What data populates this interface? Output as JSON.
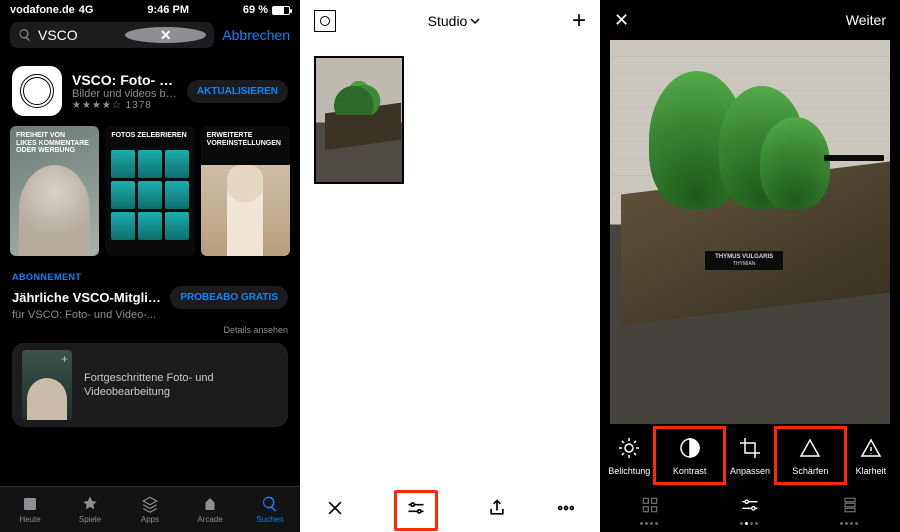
{
  "statusbar": {
    "carrier": "vodafone.de",
    "network": "4G",
    "time": "9:46 PM",
    "battery": "69 %"
  },
  "search": {
    "query": "VSCO",
    "cancel": "Abbrechen"
  },
  "app": {
    "name": "VSCO: Foto- und...",
    "subtitle": "Bilder und videos be...",
    "ratingCount": "1378",
    "action": "AKTUALISIEREN"
  },
  "shots": {
    "s1a": "FREIHEIT VON",
    "s1b": "LIKES KOMMENTARE ODER WERBUNG",
    "s2": "FOTOS ZELEBRIEREN",
    "s3": "ERWEITERTE VOREINSTELLUNGEN"
  },
  "abon": {
    "heading": "ABONNEMENT",
    "title": "Jährliche VSCO-Mitglied...",
    "subtitle": "für VSCO: Foto- und Video-...",
    "trial": "PROBEABO GRATIS",
    "details": "Details ansehen"
  },
  "promo": {
    "line1": "Fortgeschrittene Foto- und",
    "line2": "Videobearbeitung"
  },
  "tabs": {
    "heute": "Heute",
    "spiele": "Spiele",
    "apps": "Apps",
    "arcade": "Arcade",
    "suchen": "Suchen"
  },
  "studio": {
    "title": "Studio"
  },
  "editor": {
    "next": "Weiter",
    "tools": {
      "belichtung": "Belichtung",
      "kontrast": "Kontrast",
      "anpassen": "Anpassen",
      "schaerfen": "Schärfen",
      "klarheit": "Klarheit"
    },
    "sign1a": "THYMUS VULGARIS",
    "sign1b": "THYMIAN"
  }
}
